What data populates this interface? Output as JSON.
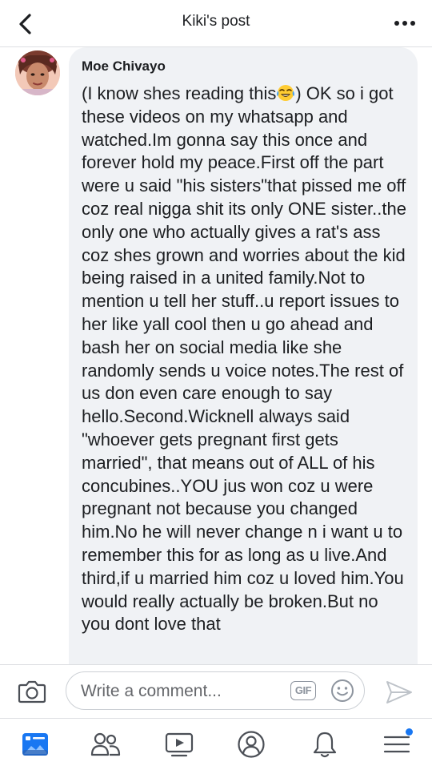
{
  "header": {
    "title": "Kiki's post",
    "back_icon": "chevron-left-icon",
    "more_icon": "more-horizontal-icon"
  },
  "comment": {
    "author": "Moe Chivayo",
    "text_before_emoji": "(I know shes reading this",
    "emoji": "face-with-tears-of-joy",
    "text_after_emoji": ") OK so i got these videos on my whatsapp and watched.Im gonna say this once and forever hold my peace.First off the part were u said \"his sisters\"that pissed me off coz real nigga shit its only ONE sister..the only one who actually gives a rat's ass coz shes grown and worries about the kid being raised in a united family.Not to mention u tell her stuff..u report issues to her like yall cool then u go ahead and bash her on social media like she randomly sends u voice notes.The rest of us don even care enough to say hello.Second.Wicknell always said \"whoever gets pregnant first gets married\", that means out of ALL of his concubines..YOU jus won coz u were pregnant not because you changed him.No he will never change n i want u to remember this for as long as u live.And third,if u married him coz u loved him.You would really actually be broken.But no you dont love that"
  },
  "composer": {
    "placeholder": "Write a comment...",
    "gif_label": "GIF",
    "camera_icon": "camera-icon",
    "emoji_icon": "smiley-icon",
    "send_icon": "send-icon"
  },
  "tabbar": {
    "items": [
      {
        "name": "news-feed",
        "icon": "news-feed-icon",
        "active": true
      },
      {
        "name": "friends",
        "icon": "friends-icon",
        "active": false
      },
      {
        "name": "watch",
        "icon": "watch-icon",
        "active": false
      },
      {
        "name": "profile",
        "icon": "profile-icon",
        "active": false
      },
      {
        "name": "notifications",
        "icon": "bell-icon",
        "active": false
      },
      {
        "name": "menu",
        "icon": "menu-icon",
        "active": false,
        "has_badge": true
      }
    ]
  },
  "colors": {
    "accent": "#1877f2",
    "bubble": "#f0f2f5",
    "icon_gray": "#4b4f56",
    "divider": "#dddfe2"
  }
}
